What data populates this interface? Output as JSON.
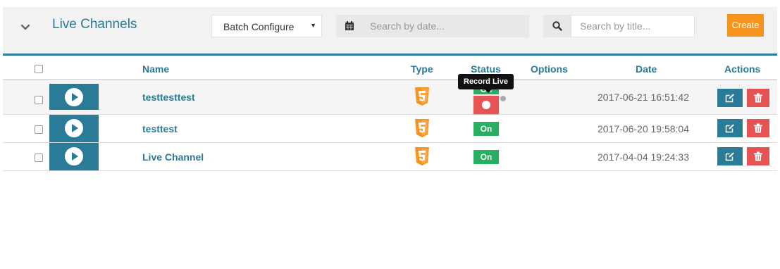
{
  "header": {
    "title": "Live Channels",
    "batch_configure_label": "Batch Configure",
    "date_search_placeholder": "Search by date...",
    "title_search_placeholder": "Search by title...",
    "create_label": "Create"
  },
  "table": {
    "columns": [
      "Name",
      "Type",
      "Status",
      "Options",
      "Date",
      "Actions"
    ],
    "rows": [
      {
        "name": "testtesttest",
        "type": "html5-icon",
        "status": "On",
        "date": "2017-06-21 16:51:42"
      },
      {
        "name": "testtest",
        "type": "html5-icon",
        "status": "On",
        "date": "2017-06-20 19:58:04"
      },
      {
        "name": "Live Channel",
        "type": "html5-icon",
        "status": "On",
        "date": "2017-04-04 19:24:33"
      }
    ]
  },
  "tooltip": {
    "text": "Record Live"
  },
  "colors": {
    "accent": "#2a7b98",
    "create": "#f7941d",
    "on": "#27ae60",
    "danger": "#e55353",
    "html5": "#f7941d"
  }
}
